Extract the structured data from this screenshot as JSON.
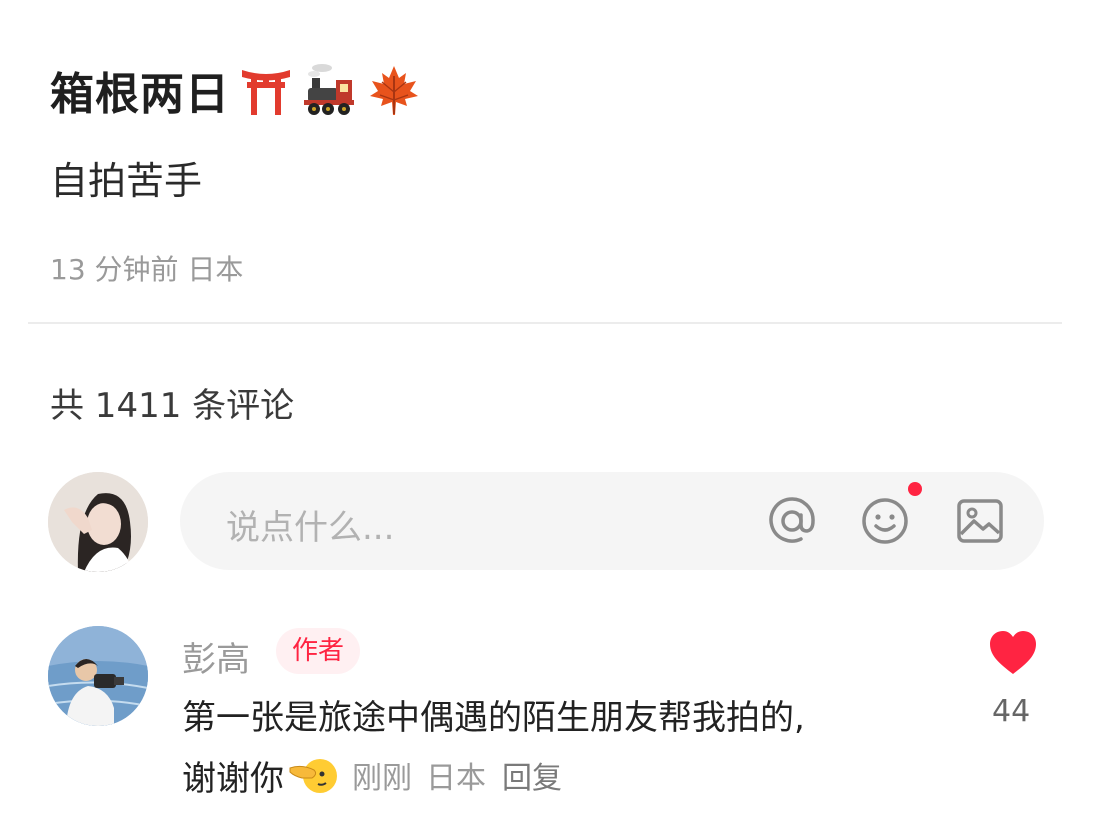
{
  "post": {
    "title": "箱根两日",
    "title_emojis": [
      "torii-gate-emoji",
      "locomotive-emoji",
      "maple-leaf-emoji"
    ],
    "description": "自拍苦手",
    "meta": "13 分钟前 日本"
  },
  "comments_section": {
    "count_label": "共 1411 条评论",
    "input": {
      "placeholder": "说点什么...",
      "tools": [
        "at-icon",
        "emoji-icon",
        "image-icon"
      ],
      "emoji_has_new_dot": true
    }
  },
  "comments": [
    {
      "author": "彭高",
      "badge": "作者",
      "text_line1": "第一张是旅途中偶遇的陌生朋友帮我拍的,",
      "text_line2": "谢谢你",
      "text_emoji": "pointing-face-emoji",
      "time": "刚刚",
      "location": "日本",
      "reply_label": "回复",
      "likes": "44",
      "liked": true
    }
  ],
  "colors": {
    "accent": "#ff2442",
    "muted_text": "#9a9a9a",
    "input_bg": "#f5f5f5"
  }
}
